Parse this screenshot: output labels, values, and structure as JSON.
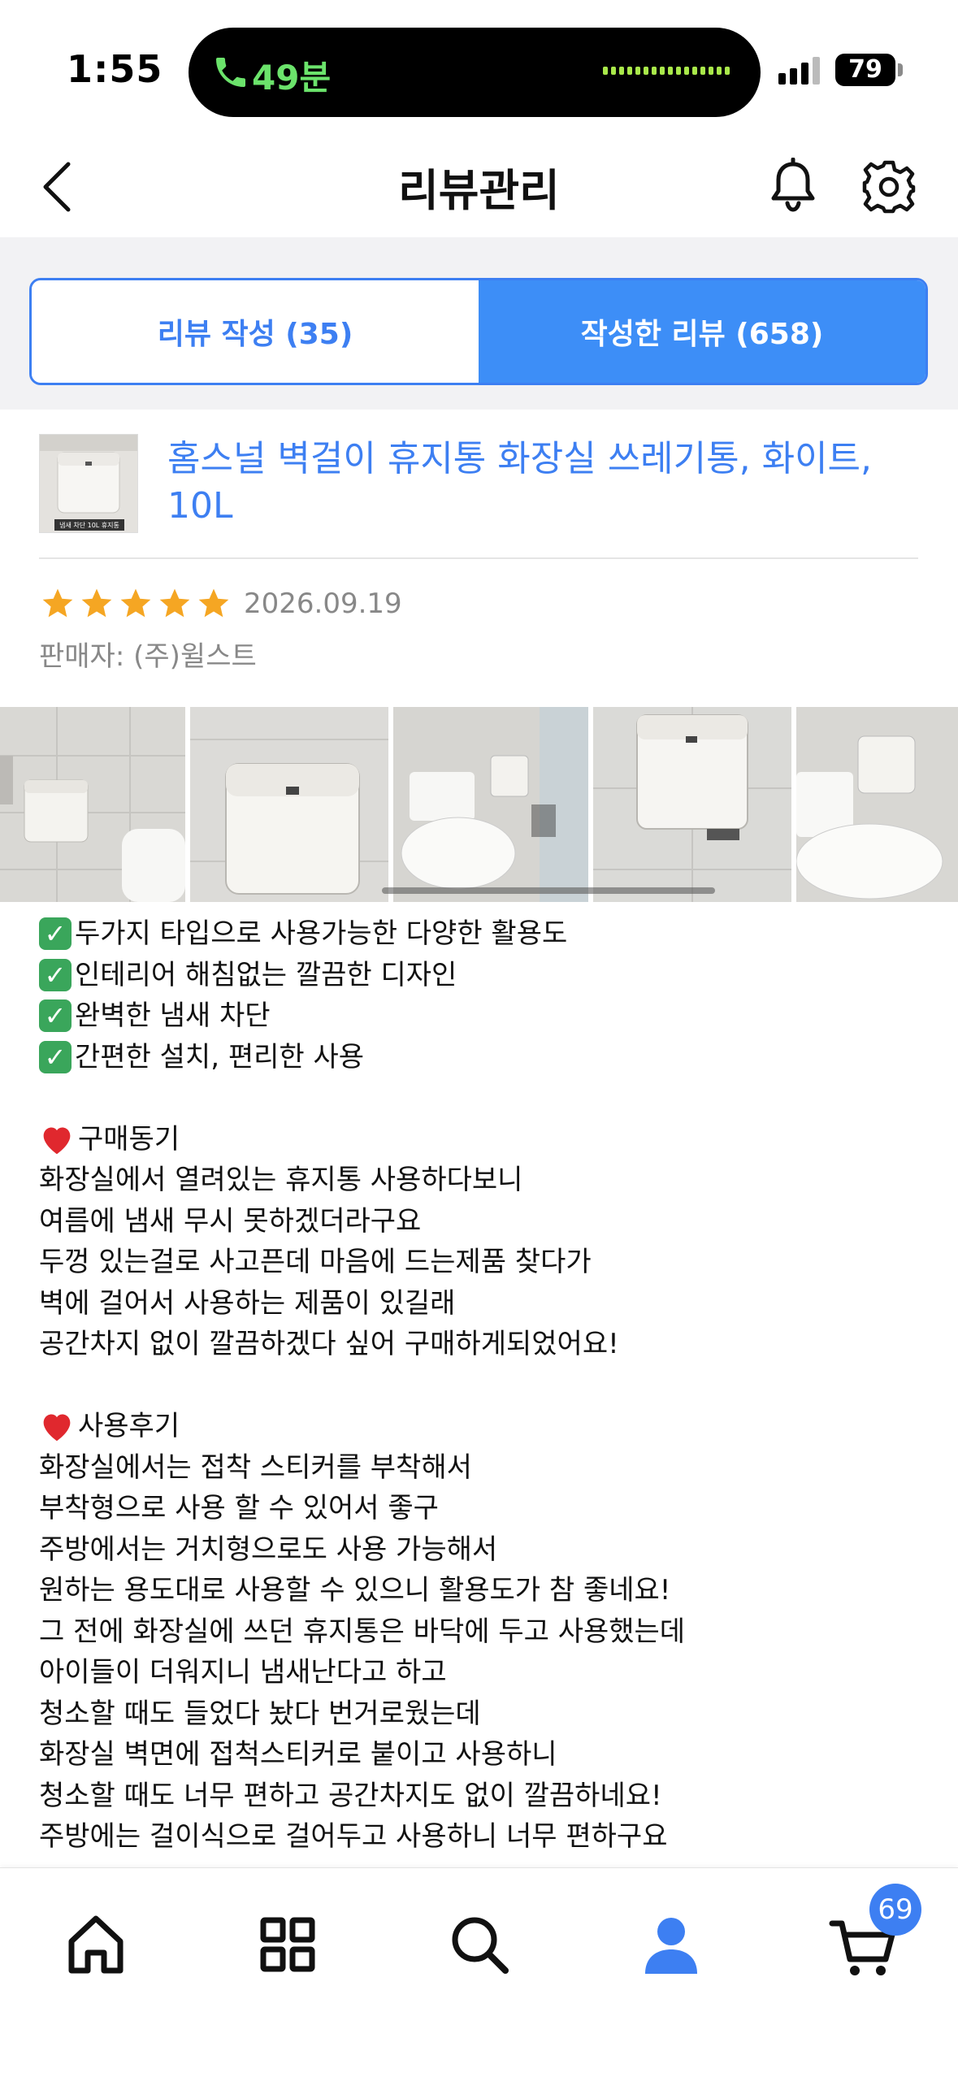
{
  "status_bar": {
    "time": "1:55",
    "call_duration": "49분",
    "battery": "79"
  },
  "header": {
    "title": "리뷰관리",
    "back_icon": "chevron-left-icon",
    "bell_icon": "bell-icon",
    "settings_icon": "gear-icon"
  },
  "tabs": [
    {
      "label": "리뷰 작성 (35)",
      "active": false
    },
    {
      "label": "작성한 리뷰 (658)",
      "active": true
    }
  ],
  "product": {
    "name": "홈스널 벽걸이 휴지통 화장실 쓰레기통, 화이트, 10L",
    "thumb_caption": "냄새 차단 10L 휴지통"
  },
  "review": {
    "rating": 5,
    "date": "2026.09.19",
    "seller": "판매자: (주)윌스트",
    "lines": [
      {
        "type": "check",
        "text": "두가지 타입으로 사용가능한 다양한 활용도"
      },
      {
        "type": "check",
        "text": "인테리어 해침없는 깔끔한 디자인"
      },
      {
        "type": "check",
        "text": "완벽한 냄새 차단"
      },
      {
        "type": "check",
        "text": "간편한 설치, 편리한 사용"
      },
      {
        "type": "blank",
        "text": ""
      },
      {
        "type": "heart",
        "text": "구매동기"
      },
      {
        "type": "text",
        "text": "화장실에서 열려있는 휴지통 사용하다보니"
      },
      {
        "type": "text",
        "text": "여름에 냄새 무시 못하겠더라구요"
      },
      {
        "type": "text",
        "text": "두껑 있는걸로 사고픈데 마음에 드는제품 찾다가"
      },
      {
        "type": "text",
        "text": "벽에 걸어서 사용하는 제품이 있길래"
      },
      {
        "type": "text",
        "text": "공간차지 없이 깔끔하겠다 싶어 구매하게되었어요!"
      },
      {
        "type": "blank",
        "text": ""
      },
      {
        "type": "heart",
        "text": "사용후기"
      },
      {
        "type": "text",
        "text": "화장실에서는 접착 스티커를 부착해서"
      },
      {
        "type": "text",
        "text": "부착형으로 사용 할 수 있어서 좋구"
      },
      {
        "type": "text",
        "text": "주방에서는 거치형으로도 사용 가능해서"
      },
      {
        "type": "text",
        "text": "원하는 용도대로 사용할 수 있으니 활용도가 참 좋네요!"
      },
      {
        "type": "text",
        "text": "그 전에 화장실에 쓰던 휴지통은 바닥에 두고 사용했는데"
      },
      {
        "type": "text",
        "text": "아이들이 더워지니 냄새난다고 하고"
      },
      {
        "type": "text",
        "text": "청소할 때도 들었다 놨다 번거로웠는데"
      },
      {
        "type": "text",
        "text": "화장실 벽면에 접척스티커로 붙이고 사용하니"
      },
      {
        "type": "text",
        "text": "청소할 때도 너무 편하고 공간차지도 없이 깔끔하네요!"
      },
      {
        "type": "text",
        "text": "주방에는 걸이식으로 걸어두고 사용하니 너무 편하구요"
      }
    ]
  },
  "bottom_nav": {
    "items": [
      {
        "icon": "home-icon",
        "active": false
      },
      {
        "icon": "category-grid-icon",
        "active": false
      },
      {
        "icon": "search-icon",
        "active": false
      },
      {
        "icon": "my-page-icon",
        "active": true
      },
      {
        "icon": "cart-icon",
        "active": false
      }
    ],
    "cart_count": "69"
  },
  "colors": {
    "accent": "#3d7ff2",
    "active_tab_bg": "#3d8ef7",
    "star": "#f5a623",
    "call_green": "#6be36b",
    "meta_gray": "#888888"
  }
}
